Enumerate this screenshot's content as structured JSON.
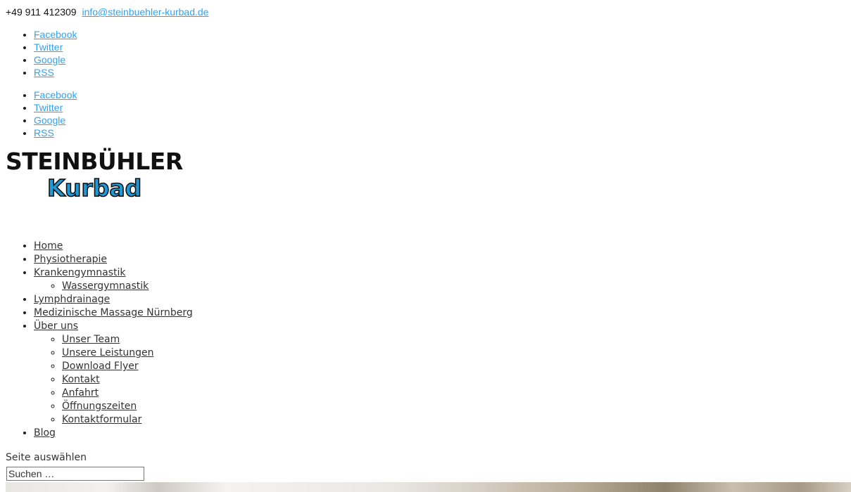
{
  "topbar": {
    "phone": "+49 911 412309",
    "email": "info@steinbuehler-kurbad.de"
  },
  "social_primary": [
    "Facebook",
    "Twitter",
    "Google",
    "RSS"
  ],
  "social_secondary": [
    "Facebook",
    "Twitter",
    "Google",
    "RSS"
  ],
  "logo": {
    "line1": "STEINBÜHLER",
    "line2": "Kurbad"
  },
  "menu": {
    "home": "Home",
    "physio": "Physiotherapie",
    "kg": "Krankengymnastik",
    "kg_sub": [
      "Wassergymnastik"
    ],
    "lymph": "Lymphdrainage",
    "massage": "Medizinische Massage Nürnberg",
    "about": "Über uns",
    "about_sub": [
      "Unser Team",
      "Unsere Leistungen",
      "Download Flyer",
      "Kontakt",
      "Anfahrt",
      "Öffnungszeiten",
      "Kontaktformular"
    ],
    "blog": "Blog"
  },
  "select_page_label": "Seite auswählen",
  "search": {
    "placeholder": "Suchen …"
  }
}
